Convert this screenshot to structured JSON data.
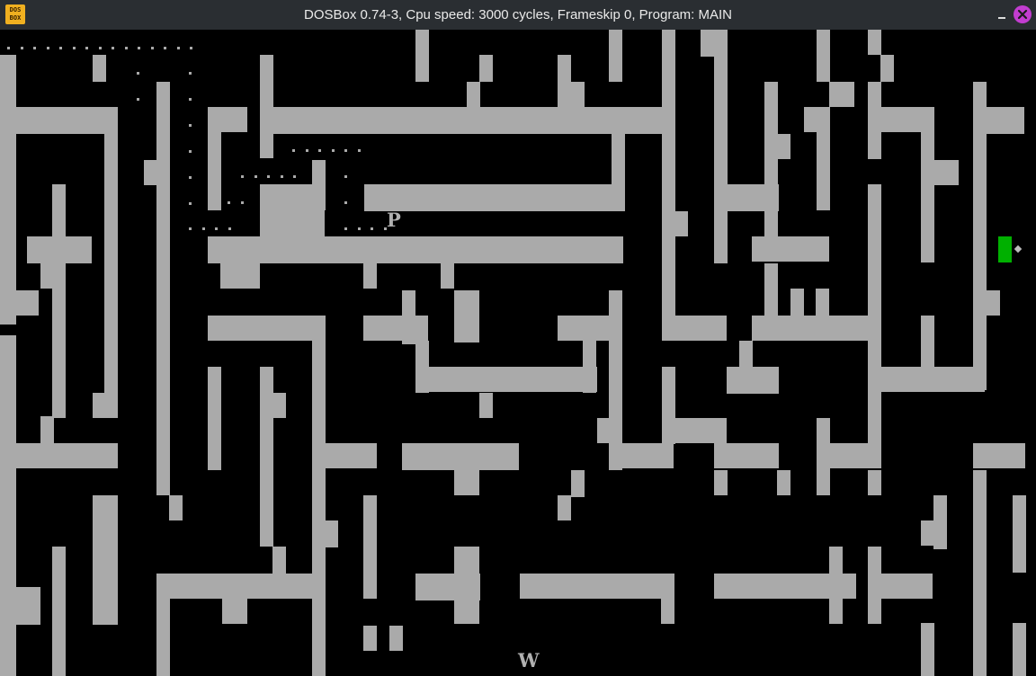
{
  "window": {
    "title": "DOSBox 0.74-3, Cpu speed: 3000 cycles, Frameskip 0, Program: MAIN",
    "app_icon": "dosbox-icon",
    "app_icon_text": [
      "DOS",
      "BOX"
    ],
    "controls": [
      "minimize-icon",
      "close-icon"
    ],
    "close_color": "#c23dd0"
  },
  "game": {
    "wall_color": "#aaaaaa",
    "background_color": "#000000",
    "player_cursor_color": "#00b000",
    "markers": [
      {
        "id": "marker-p",
        "text": "P"
      },
      {
        "id": "marker-w",
        "text": "W"
      }
    ]
  }
}
